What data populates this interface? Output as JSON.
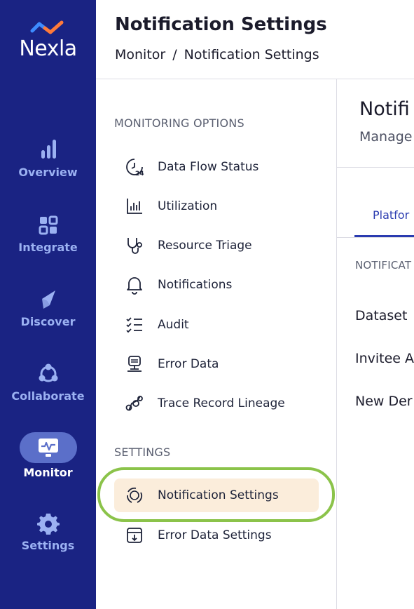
{
  "app": {
    "logo_text": "Nexla",
    "nav": [
      {
        "label": "Overview",
        "icon": "bar-chart-icon"
      },
      {
        "label": "Integrate",
        "icon": "integrate-icon"
      },
      {
        "label": "Discover",
        "icon": "compass-icon"
      },
      {
        "label": "Collaborate",
        "icon": "collaborate-icon"
      },
      {
        "label": "Monitor",
        "icon": "monitor-icon",
        "active": true
      },
      {
        "label": "Settings",
        "icon": "gear-icon"
      }
    ]
  },
  "header": {
    "title": "Notification Settings",
    "breadcrumb": [
      "Monitor",
      "Notification Settings"
    ],
    "breadcrumb_separator": "/"
  },
  "menu": {
    "monitoring_heading": "MONITORING OPTIONS",
    "monitoring_items": [
      {
        "label": "Data Flow Status",
        "icon": "clock-24-icon"
      },
      {
        "label": "Utilization",
        "icon": "bar-graph-icon"
      },
      {
        "label": "Resource Triage",
        "icon": "stethoscope-icon"
      },
      {
        "label": "Notifications",
        "icon": "bell-icon"
      },
      {
        "label": "Audit",
        "icon": "checklist-icon"
      },
      {
        "label": "Error Data",
        "icon": "error-data-icon"
      },
      {
        "label": "Trace Record Lineage",
        "icon": "lineage-icon"
      }
    ],
    "settings_heading": "SETTINGS",
    "settings_items": [
      {
        "label": "Notification Settings",
        "icon": "notification-settings-icon",
        "selected": true
      },
      {
        "label": "Error Data Settings",
        "icon": "error-data-settings-icon"
      }
    ]
  },
  "content": {
    "title": "Notifi",
    "subtitle": "Manage",
    "tab": "Platfor",
    "section": "NOTIFICAT",
    "rows": [
      "Dataset",
      "Invitee A",
      "New Der"
    ]
  },
  "colors": {
    "rail": "#1a2383",
    "rail_label": "#9bb1f2",
    "active_pill": "#5b6fc9",
    "selected_item_bg": "#fbeddb",
    "highlight_ring": "#8bc34a",
    "tab_accent": "#2a3bb0"
  }
}
